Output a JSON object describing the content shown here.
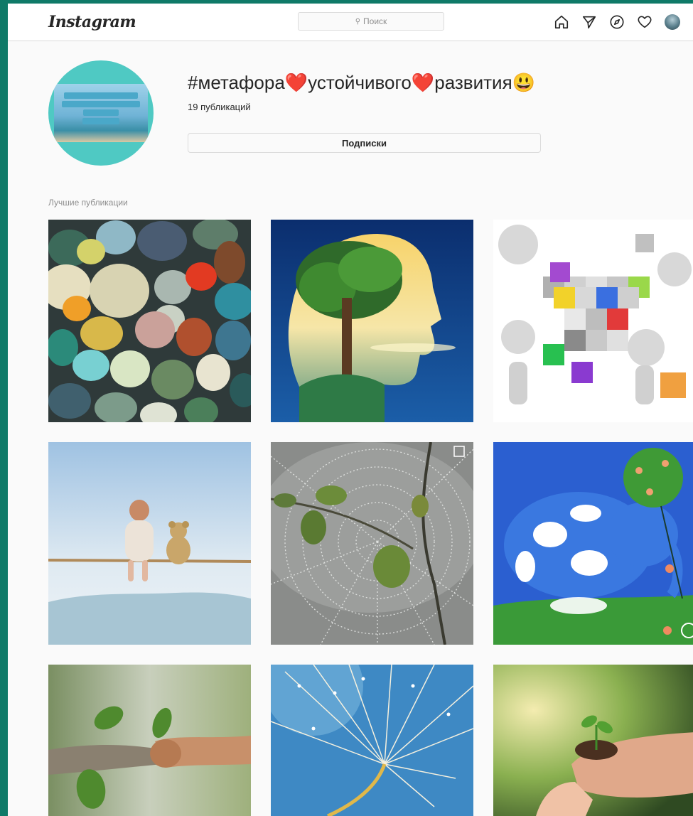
{
  "header": {
    "logo": "Instagram",
    "search_placeholder": "Поиск",
    "icons": [
      "home-icon",
      "direct-icon",
      "explore-icon",
      "activity-icon",
      "profile-avatar"
    ]
  },
  "hashtag": {
    "title": "#метафора❤️устойчивого❤️развития😃",
    "post_count": "19 публикаций",
    "follow_button": "Подписки"
  },
  "top_posts": {
    "label": "Лучшие публикации",
    "tiles": [
      {
        "subject": "sea-glass-pebbles"
      },
      {
        "subject": "tree-head-silhouette"
      },
      {
        "subject": "3d-figures-cube"
      },
      {
        "subject": "baby-and-teddy-on-rope"
      },
      {
        "subject": "dew-spider-web"
      },
      {
        "subject": "blue-elephant-painting"
      },
      {
        "subject": "branch-hand-handshake"
      },
      {
        "subject": "dandelion-seeds"
      },
      {
        "subject": "hands-holding-sprout"
      }
    ]
  },
  "colors": {
    "frame": "#0f7a68",
    "page_background": "#fafafa",
    "border": "#dbdbdb",
    "muted_text": "#8e8e8e"
  }
}
